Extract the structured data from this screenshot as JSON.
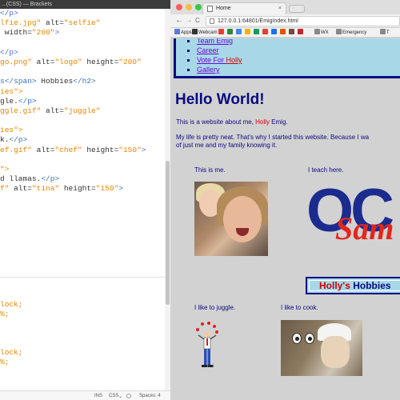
{
  "editor": {
    "title": "...(CSS) — Brackets",
    "code_lines": [
      [
        [
          "</p>",
          "tag"
        ]
      ],
      [
        [
          "lfie.jpg\"",
          "str"
        ],
        [
          " alt=",
          "txt"
        ],
        [
          "\"selfie\"",
          "str"
        ]
      ],
      [
        [
          " width=",
          "txt"
        ],
        [
          "\"200\"",
          "str"
        ],
        [
          ">",
          "tag"
        ]
      ],
      [
        [
          "",
          "txt"
        ]
      ],
      [
        [
          "</p>",
          "tag"
        ]
      ],
      [
        [
          "go.png\"",
          "str"
        ],
        [
          " alt=",
          "txt"
        ],
        [
          "\"logo\"",
          "str"
        ],
        [
          " height=",
          "txt"
        ],
        [
          "\"200\"",
          "str"
        ]
      ],
      [
        [
          "",
          "txt"
        ]
      ],
      [
        [
          "s</span>",
          "tag"
        ],
        [
          " Hobbies",
          "txt"
        ],
        [
          "</h2>",
          "tag"
        ]
      ],
      [
        [
          "ies\">",
          "str"
        ]
      ],
      [
        [
          "gle.",
          "txt"
        ],
        [
          "</p>",
          "tag"
        ]
      ],
      [
        [
          "ggle.gif\"",
          "str"
        ],
        [
          " alt=",
          "txt"
        ],
        [
          "\"juggle\"",
          "str"
        ]
      ],
      [
        [
          "",
          "txt"
        ]
      ],
      [
        [
          "ies\">",
          "str"
        ]
      ],
      [
        [
          "k.",
          "txt"
        ],
        [
          "</p>",
          "tag"
        ]
      ],
      [
        [
          "ef.gif\"",
          "str"
        ],
        [
          " alt=",
          "txt"
        ],
        [
          "\"chef\"",
          "str"
        ],
        [
          " height=",
          "txt"
        ],
        [
          "\"150\"",
          "str"
        ],
        [
          ">",
          "tag"
        ]
      ],
      [
        [
          "",
          "txt"
        ]
      ],
      [
        [
          "\">",
          "str"
        ]
      ],
      [
        [
          "d llamas.",
          "txt"
        ],
        [
          "</p>",
          "tag"
        ]
      ],
      [
        [
          "f\"",
          "str"
        ],
        [
          " alt=",
          "txt"
        ],
        [
          "\"tina\"",
          "str"
        ],
        [
          " height=",
          "txt"
        ],
        [
          "\"150\"",
          "str"
        ],
        [
          ">",
          "tag"
        ]
      ]
    ],
    "css_lines": [
      [
        [
          "lock;",
          "str"
        ]
      ],
      [
        [
          "%;",
          "str"
        ]
      ],
      [
        [
          "lock;",
          "str"
        ]
      ],
      [
        [
          "%;",
          "str"
        ]
      ]
    ],
    "status": {
      "mode": "INS",
      "language": "CSS",
      "spaces": "Spaces: 4"
    }
  },
  "browser": {
    "tab_title": "Home",
    "tab_close": "×",
    "url": "127.0.0.1:64801/EmigIndex.html",
    "nav": {
      "back": "←",
      "forward": "→",
      "reload": "C"
    },
    "bookmarks": [
      {
        "label": "Apps",
        "color": "#5a7bd8"
      },
      {
        "label": "Webcam",
        "color": "#333333"
      },
      {
        "label": "",
        "color": "#e34133"
      },
      {
        "label": "",
        "color": "#2b8a3e"
      },
      {
        "label": "",
        "color": "#4285f4"
      },
      {
        "label": "",
        "color": "#f4b400"
      },
      {
        "label": "",
        "color": "#0f9d58"
      },
      {
        "label": "",
        "color": "#db4437"
      },
      {
        "label": "",
        "color": "#1a73e8"
      },
      {
        "label": "",
        "color": "#e65100"
      },
      {
        "label": "",
        "color": "#6d4c41"
      },
      {
        "label": "",
        "color": "#c62828"
      },
      {
        "label": "WX",
        "color": "#888888"
      },
      {
        "label": "Emergency",
        "color": "#888888"
      },
      {
        "label": "T",
        "color": "#888888"
      }
    ]
  },
  "page": {
    "nav_links": [
      {
        "label": "Team Emig",
        "style": "normal"
      },
      {
        "label": "Career",
        "style": "normal"
      },
      {
        "label": "Vote For ",
        "style": "normal",
        "suffix": "Holly"
      },
      {
        "label": "Gallery",
        "style": "normal"
      }
    ],
    "heading": "Hello World!",
    "intro_before": "This is a website about me, ",
    "intro_name": "Holly",
    "intro_after": " Emig.",
    "para_line1": "My life is pretty neat. That's why I started this website. Because I wa",
    "para_line2": "of just me and my family knowing it.",
    "caption_me": "This is me.",
    "caption_teach": "I teach here.",
    "logo_top": "OC",
    "logo_script": "Sam",
    "hobbies_name": "Holly's",
    "hobbies_word": " Hobbies",
    "caption_juggle": "I like to juggle.",
    "caption_cook": "I like to cook."
  }
}
